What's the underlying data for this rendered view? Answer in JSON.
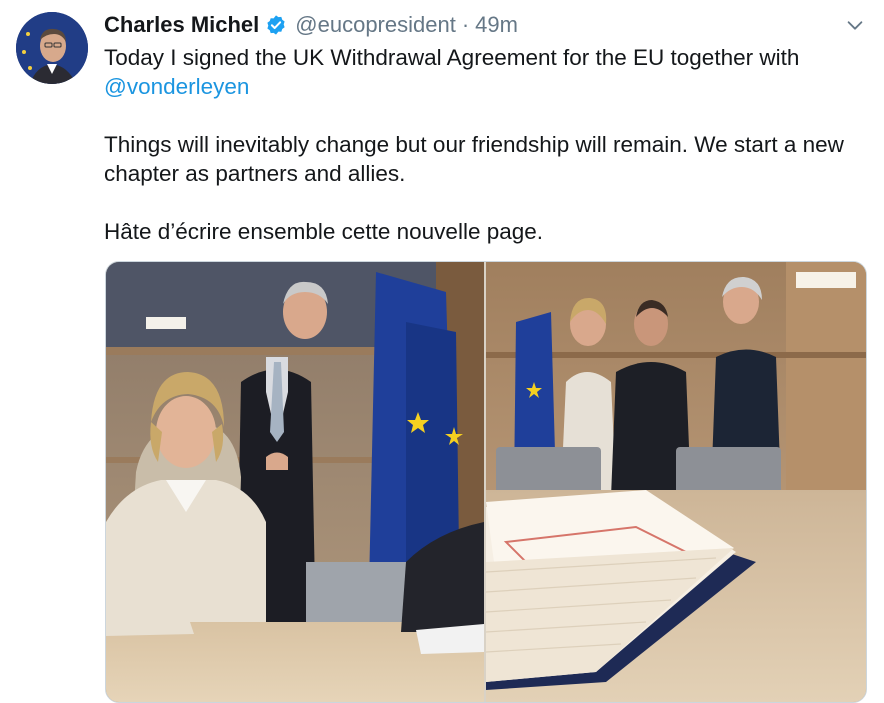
{
  "author": {
    "name": "Charles Michel",
    "handle": "@eucopresident",
    "separator": "·",
    "time": "49m"
  },
  "tweet": {
    "line1_before_mention": "Today I signed the UK Withdrawal Agreement for the EU together with ",
    "mention": "@vonderleyen",
    "paragraph2": "Things will inevitably change but our friendship will remain. We start a new chapter as partners and allies.",
    "paragraph3": "Hâte d’écrire ensemble cette nouvelle page."
  },
  "colors": {
    "link": "#1b95e0",
    "verified": "#1da1f2",
    "secondary_text": "#657786"
  },
  "icons": [
    "verified-badge-icon",
    "chevron-down-icon"
  ]
}
